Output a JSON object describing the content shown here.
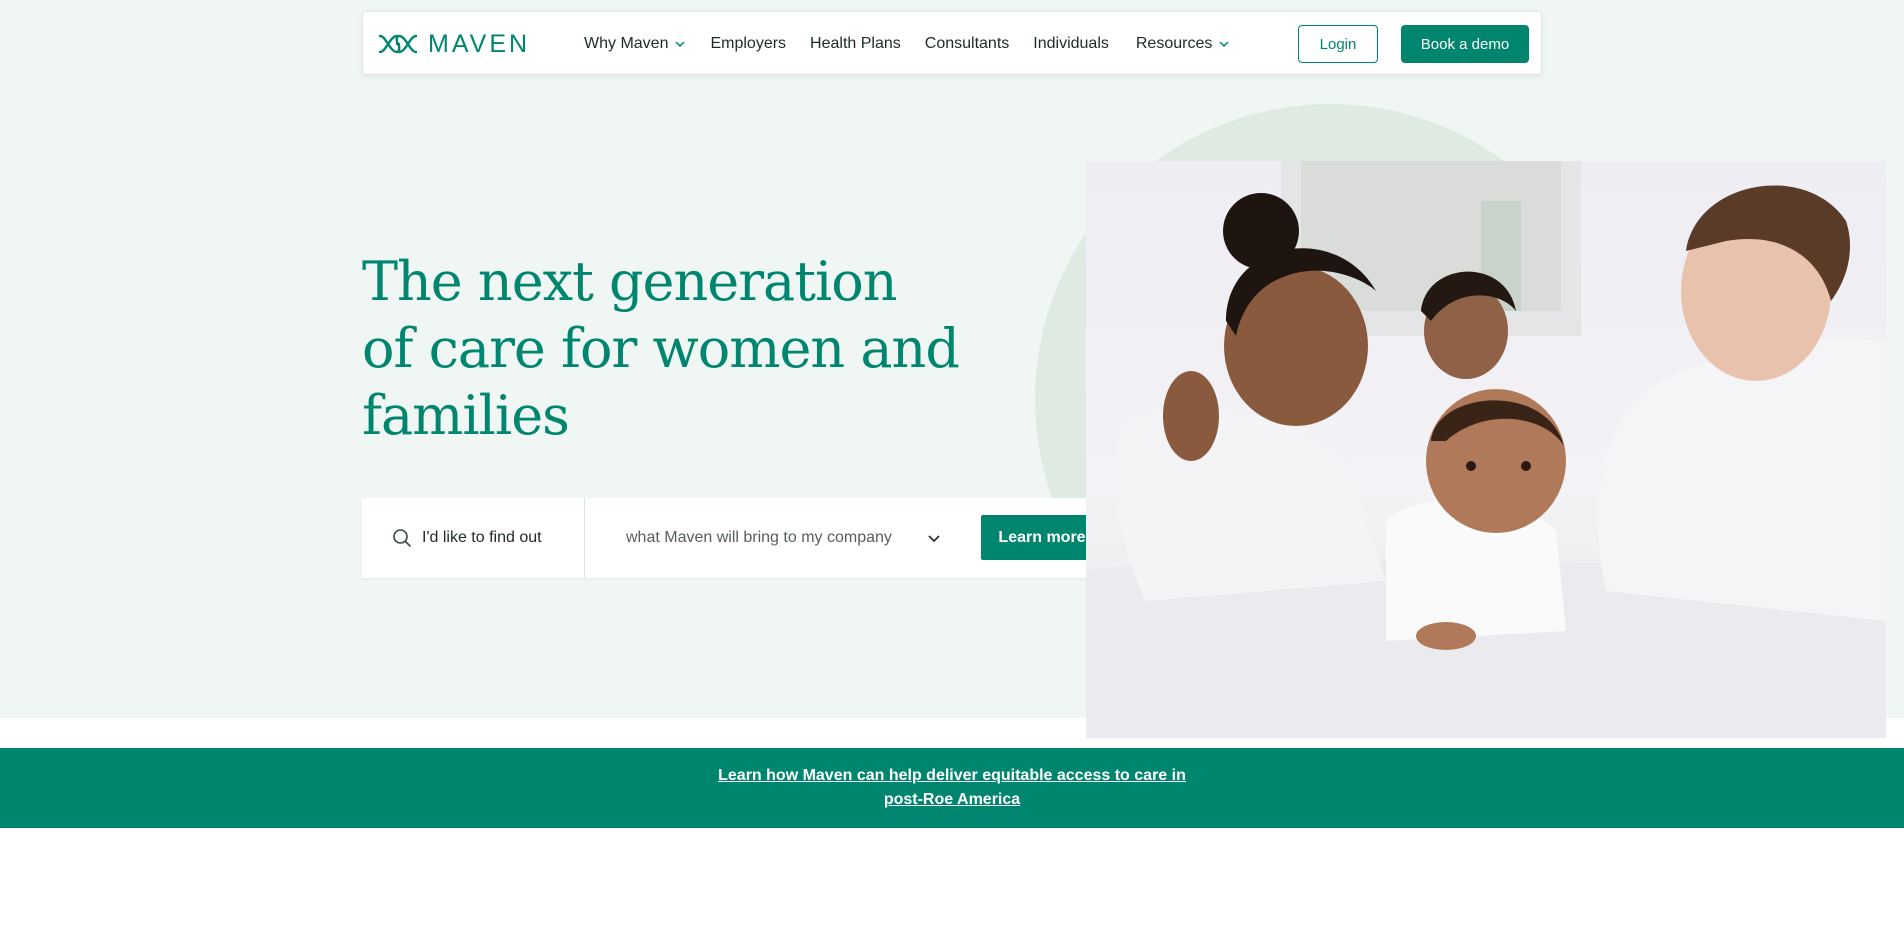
{
  "brand": {
    "name": "MAVEN",
    "color": "#00856f",
    "logo_icon": "double-loop-icon"
  },
  "nav": {
    "items": [
      {
        "label": "Why Maven",
        "has_dropdown": true
      },
      {
        "label": "Employers",
        "has_dropdown": false
      },
      {
        "label": "Health Plans",
        "has_dropdown": false
      },
      {
        "label": "Consultants",
        "has_dropdown": false
      },
      {
        "label": "Individuals",
        "has_dropdown": false
      },
      {
        "label": "Resources",
        "has_dropdown": true
      }
    ],
    "login_label": "Login",
    "demo_label": "Book a demo"
  },
  "hero": {
    "headline": "The next generation of care for women and families",
    "finder": {
      "prefix": "I'd like to find out",
      "selected_option": "what Maven will bring to my company",
      "button_label": "Learn more"
    },
    "photo_subject": "family on bed with baby"
  },
  "banner": {
    "link_text": "Learn how Maven can help deliver equitable access to care in post-Roe America"
  }
}
